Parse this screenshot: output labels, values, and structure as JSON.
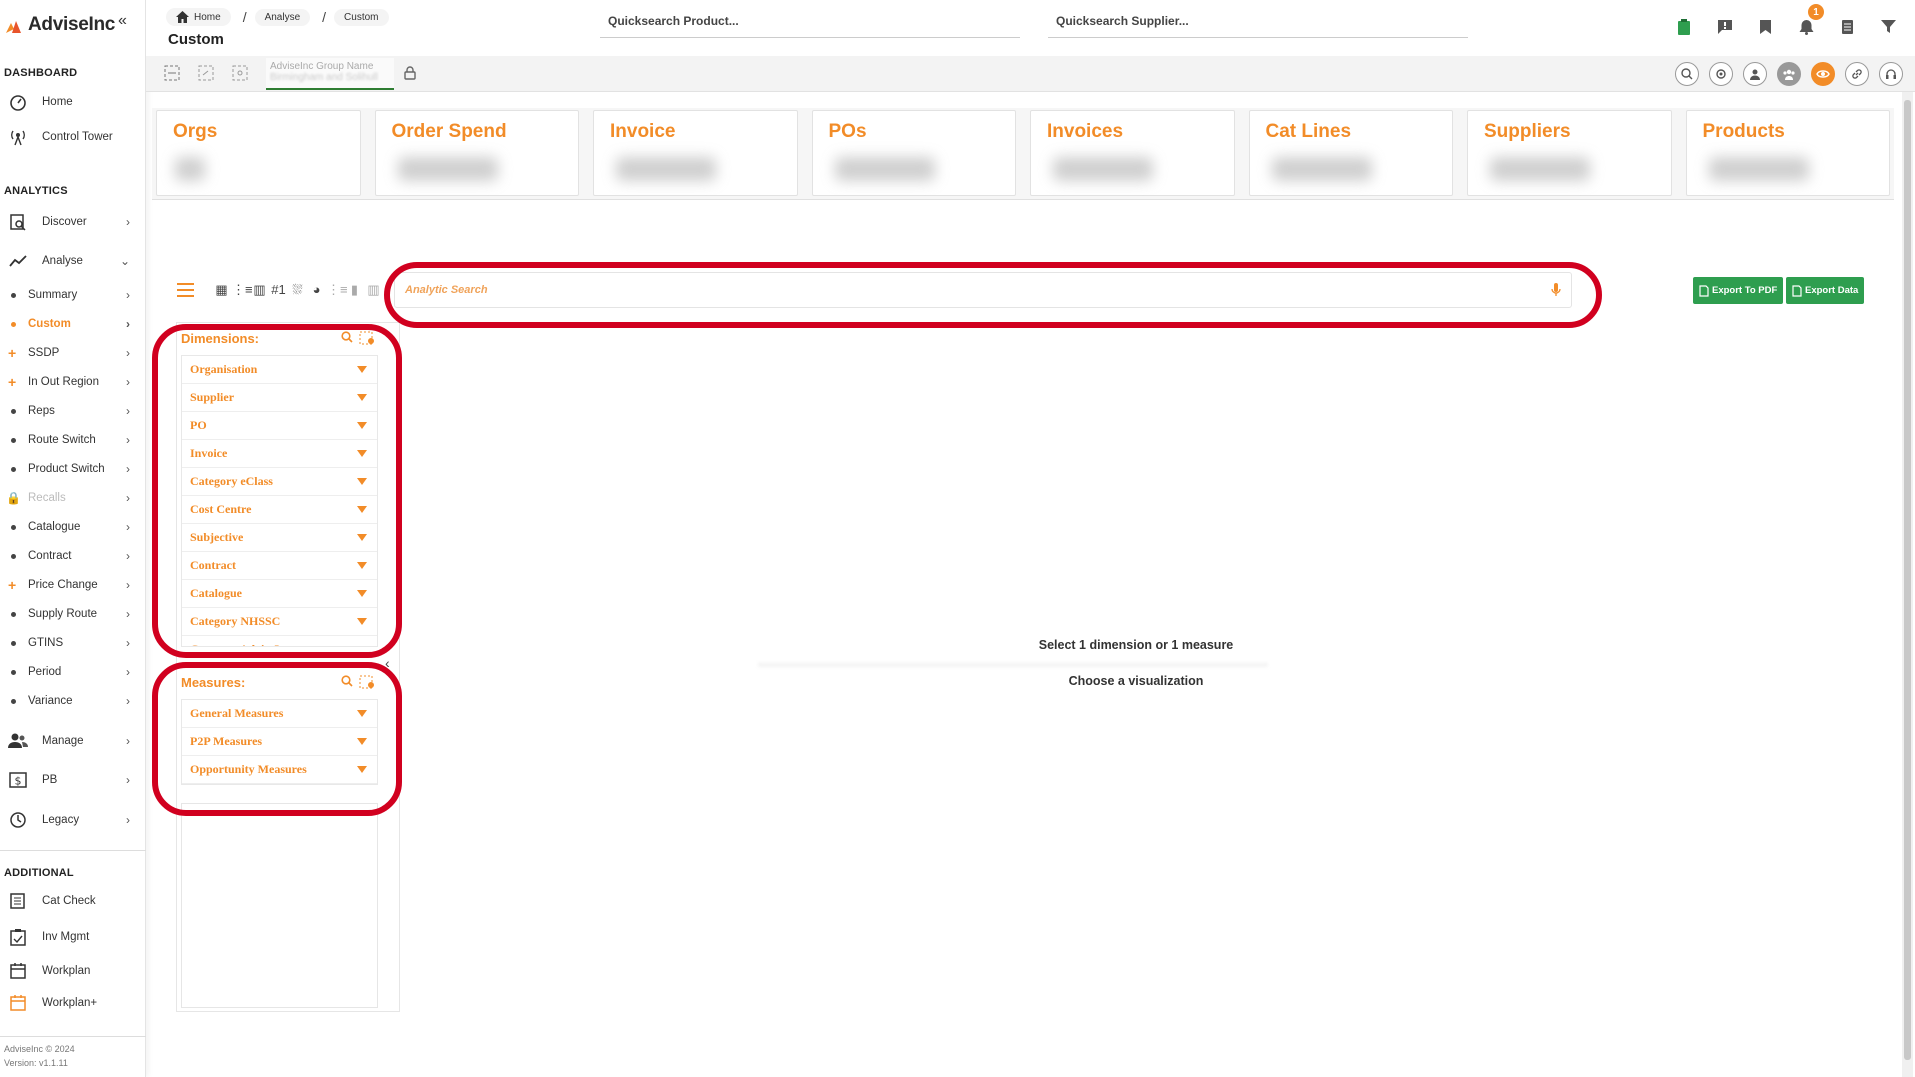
{
  "brand": {
    "name": "AdviseInc",
    "accent": "#f28c28",
    "green": "#2e9e4f",
    "ring": "#d1001f"
  },
  "sidebar": {
    "sections": {
      "dashboard": "DASHBOARD",
      "analytics": "ANALYTICS",
      "additional": "ADDITIONAL"
    },
    "dashboard_items": [
      {
        "label": "Home",
        "icon": "gauge-icon"
      },
      {
        "label": "Control Tower",
        "icon": "antenna-icon"
      }
    ],
    "discover": {
      "label": "Discover",
      "icon": "discover-icon"
    },
    "analyse": {
      "label": "Analyse",
      "icon": "trend-icon"
    },
    "analyse_sub": [
      {
        "label": "Summary",
        "marker": "dot"
      },
      {
        "label": "Custom",
        "marker": "dot",
        "active": true
      },
      {
        "label": "SSDP",
        "marker": "plus"
      },
      {
        "label": "In Out Region",
        "marker": "plus"
      },
      {
        "label": "Reps",
        "marker": "dot"
      },
      {
        "label": "Route Switch",
        "marker": "dot"
      },
      {
        "label": "Product Switch",
        "marker": "dot"
      },
      {
        "label": "Recalls",
        "marker": "lock",
        "disabled": true
      },
      {
        "label": "Catalogue",
        "marker": "dot"
      },
      {
        "label": "Contract",
        "marker": "dot"
      },
      {
        "label": "Price Change",
        "marker": "plus"
      },
      {
        "label": "Supply Route",
        "marker": "dot"
      },
      {
        "label": "GTINS",
        "marker": "dot"
      },
      {
        "label": "Period",
        "marker": "dot"
      },
      {
        "label": "Variance",
        "marker": "dot"
      }
    ],
    "other_items": [
      {
        "label": "Manage",
        "icon": "users-icon"
      },
      {
        "label": "PB",
        "icon": "dollar-icon"
      },
      {
        "label": "Legacy",
        "icon": "history-icon"
      }
    ],
    "additional_items": [
      {
        "label": "Cat Check",
        "icon": "list-icon"
      },
      {
        "label": "Inv Mgmt",
        "icon": "clipboard-icon"
      },
      {
        "label": "Workplan",
        "icon": "calendar-icon"
      },
      {
        "label": "Workplan+",
        "icon": "calendar-plus-icon"
      }
    ],
    "footer": {
      "copyright": "AdviseInc © 2024",
      "version": "Version: v1.1.11"
    }
  },
  "header": {
    "breadcrumb": [
      "Home",
      "Analyse",
      "Custom"
    ],
    "title": "Custom",
    "quicksearch_product": "Quicksearch Product...",
    "quicksearch_supplier": "Quicksearch Supplier...",
    "notification_count": "1"
  },
  "toolbar": {
    "org_label": "AdviseInc Group Name",
    "org_sub": "Birmingham and Solihull"
  },
  "kpis": [
    "Orgs",
    "Order Spend",
    "Invoice",
    "POs",
    "Invoices",
    "Cat Lines",
    "Suppliers",
    "Products"
  ],
  "analytics": {
    "search_placeholder": "Analytic Search",
    "export_pdf": "Export To PDF",
    "export_data": "Export Data",
    "dimensions_title": "Dimensions:",
    "dimensions": [
      "Organisation",
      "Supplier",
      "PO",
      "Invoice",
      "Category eClass",
      "Cost Centre",
      "Subjective",
      "Contract",
      "Catalogue",
      "Category NHSSC",
      "Category AdviseInc"
    ],
    "measures_title": "Measures:",
    "measures": [
      "General Measures",
      "P2P Measures",
      "Opportunity Measures"
    ],
    "msg_primary": "Select 1 dimension or 1 measure",
    "msg_secondary": "Choose a visualization"
  }
}
